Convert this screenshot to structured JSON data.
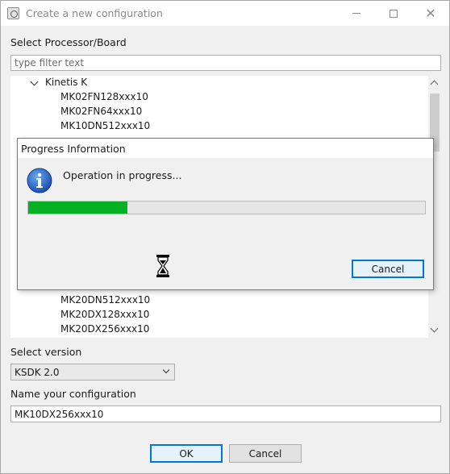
{
  "window": {
    "title": "Create a new configuration",
    "minimize_glyph": "",
    "close_glyph": "✕"
  },
  "processor": {
    "label": "Select Processor/Board",
    "filter_placeholder": "type filter text",
    "tree": {
      "group_label": "Kinetis K",
      "items_above": [
        "MK02FN128xxx10",
        "MK02FN64xxx10",
        "MK10DN512xxx10"
      ],
      "items_below": [
        "MK20DN512xxx10",
        "MK20DX128xxx10",
        "MK20DX256xxx10"
      ]
    }
  },
  "version": {
    "label": "Select version",
    "selected": "KSDK 2.0"
  },
  "configuration": {
    "label": "Name your configuration",
    "value": "MK10DX256xxx10"
  },
  "buttons": {
    "ok": "OK",
    "cancel": "Cancel"
  },
  "progress_dialog": {
    "title": "Progress Information",
    "message": "Operation in progress...",
    "progress_percent": 25,
    "cancel": "Cancel",
    "progress_color": "#06b025",
    "icon": "info-icon"
  },
  "colors": {
    "accent": "#0078d7",
    "progress": "#06b025"
  }
}
